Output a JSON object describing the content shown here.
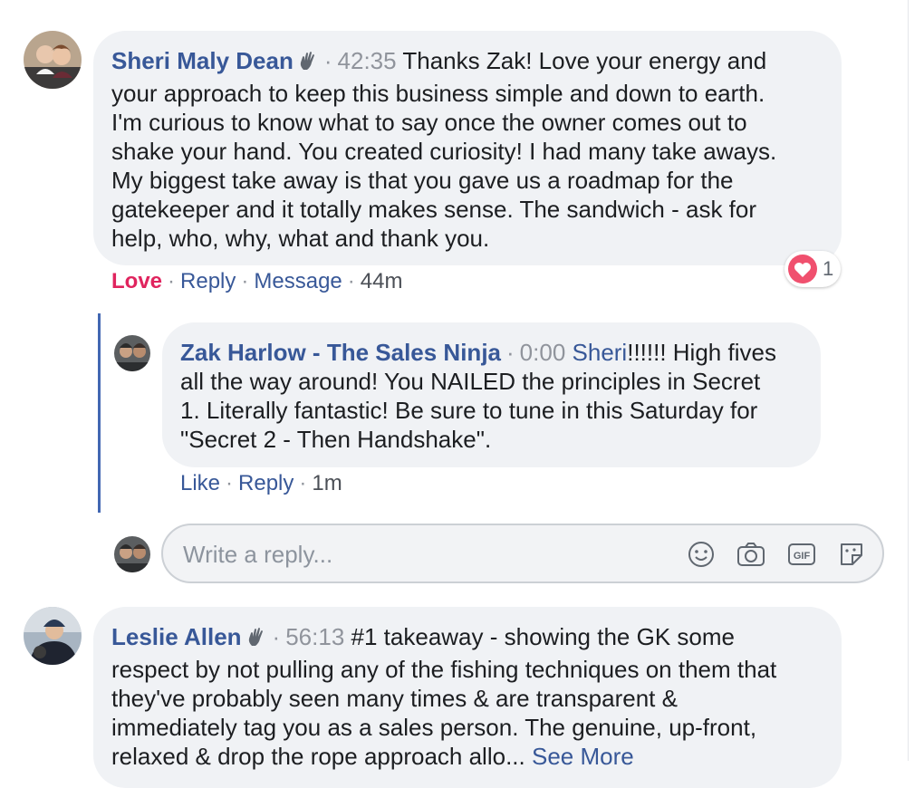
{
  "comment1": {
    "name": "Sheri Maly Dean",
    "timestamp": "42:35",
    "lines": [
      "Thanks Zak! Love your energy and",
      "your approach to keep this business simple and down to earth.",
      "I'm curious to know what to say once the owner comes out to",
      "shake your hand. You created curiosity! I had many take aways.",
      "My biggest take away is that you gave us a roadmap for the",
      "gatekeeper and it totally makes sense. The sandwich - ask for",
      "help, who, why, what and thank you."
    ],
    "reaction_count": "1",
    "actions": {
      "love": "Love",
      "reply": "Reply",
      "message": "Message",
      "age": "44m"
    }
  },
  "reply1": {
    "name": "Zak Harlow - The Sales Ninja",
    "timestamp": "0:00",
    "mention": "Sheri",
    "first_line_rest": "!!!!!! High fives",
    "lines": [
      "all the way around! You NAILED the principles in Secret",
      "1. Literally fantastic! Be sure to tune in this Saturday for",
      "\"Secret 2 - Then Handshake\"."
    ],
    "actions": {
      "like": "Like",
      "reply": "Reply",
      "age": "1m"
    }
  },
  "reply_box": {
    "placeholder": "Write a reply...",
    "icons": [
      "emoji-icon",
      "camera-icon",
      "gif-icon",
      "sticker-icon"
    ]
  },
  "comment2": {
    "name": "Leslie Allen",
    "timestamp": "56:13",
    "lines": [
      "#1 takeaway - showing the GK some",
      "respect by not pulling any of the fishing techniques on them that",
      "they've probably seen many times & are transparent &",
      "immediately tag you as a sales person. The genuine, up-front,",
      "relaxed & drop the rope approach allo..."
    ],
    "see_more": "See More"
  },
  "colors": {
    "name_blue": "#385898",
    "love_red": "#e0245e",
    "rail_blue": "#4267b2",
    "bubble_grey": "#f0f2f5"
  }
}
